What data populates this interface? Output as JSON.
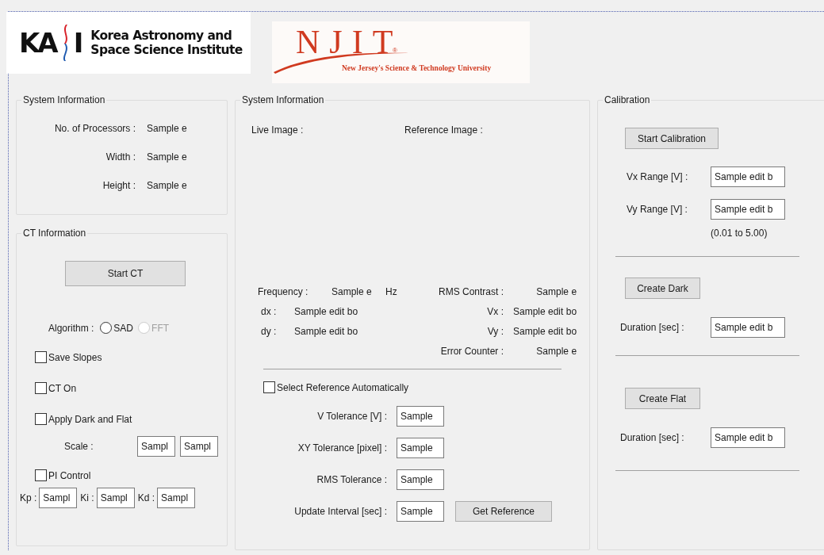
{
  "logos": {
    "kasi": {
      "mark_start": "KA",
      "mark_end": "I",
      "name": [
        "Korea Astronomy and",
        "Space Science Institute"
      ]
    },
    "njit": {
      "mark": "NJIT",
      "registered": "®",
      "tagline": "New Jersey's Science & Technology University"
    }
  },
  "system_info": {
    "title": "System Information",
    "rows": [
      {
        "label": "No. of Processors :",
        "value": "Sample e"
      },
      {
        "label": "Width :",
        "value": "Sample e"
      },
      {
        "label": "Height :",
        "value": "Sample e"
      }
    ]
  },
  "ct_info": {
    "title": "CT Information",
    "start_button": "Start CT",
    "algorithm": {
      "label": "Algorithm :",
      "options": [
        {
          "label": "SAD",
          "selected": false,
          "disabled": false
        },
        {
          "label": "FFT",
          "selected": false,
          "disabled": true
        }
      ]
    },
    "checks": [
      {
        "label": "Save Slopes",
        "checked": false
      },
      {
        "label": "CT On",
        "checked": false
      },
      {
        "label": "Apply Dark and Flat",
        "checked": false
      }
    ],
    "scale": {
      "label": "Scale :",
      "fields": [
        "Sampl",
        "Sampl"
      ]
    },
    "pi_control": {
      "label": "PI Control",
      "checked": false
    },
    "gains": [
      {
        "label": "Kp :",
        "value": "Sampl"
      },
      {
        "label": "Ki :",
        "value": "Sampl"
      },
      {
        "label": "Kd :",
        "value": "Sampl"
      }
    ]
  },
  "monitor": {
    "title": "System Information",
    "images": [
      {
        "label": "Live Image :"
      },
      {
        "label": "Reference Image :"
      }
    ],
    "frequency": {
      "label": "Frequency :",
      "value": "Sample e",
      "unit": "Hz"
    },
    "left_stats": [
      {
        "label": "dx :",
        "value": "Sample edit bo"
      },
      {
        "label": "dy :",
        "value": "Sample edit bo"
      }
    ],
    "right_stats": [
      {
        "label": "RMS Contrast :",
        "value": "Sample e"
      },
      {
        "label": "Vx :",
        "value": "Sample edit bo"
      },
      {
        "label": "Vy :",
        "value": "Sample edit bo"
      },
      {
        "label": "Error Counter :",
        "value": "Sample e"
      }
    ],
    "auto_reference": {
      "label": "Select Reference Automatically",
      "checked": false
    },
    "tolerances": [
      {
        "label": "V Tolerance [V] :",
        "value": "Sample"
      },
      {
        "label": "XY Tolerance [pixel] :",
        "value": "Sample"
      },
      {
        "label": "RMS Tolerance :",
        "value": "Sample"
      },
      {
        "label": "Update Interval [sec] :",
        "value": "Sample"
      }
    ],
    "get_reference_button": "Get Reference"
  },
  "calibration": {
    "title": "Calibration",
    "start_button": "Start Calibration",
    "ranges": [
      {
        "label": "Vx Range [V] :",
        "value": "Sample edit b"
      },
      {
        "label": "Vy Range [V] :",
        "value": "Sample edit b"
      }
    ],
    "range_hint": "(0.01 to 5.00)",
    "sections": [
      {
        "button": "Create Dark",
        "label": "Duration [sec] :",
        "value": "Sample edit b"
      },
      {
        "button": "Create Flat",
        "label": "Duration [sec] :",
        "value": "Sample edit b"
      }
    ]
  }
}
